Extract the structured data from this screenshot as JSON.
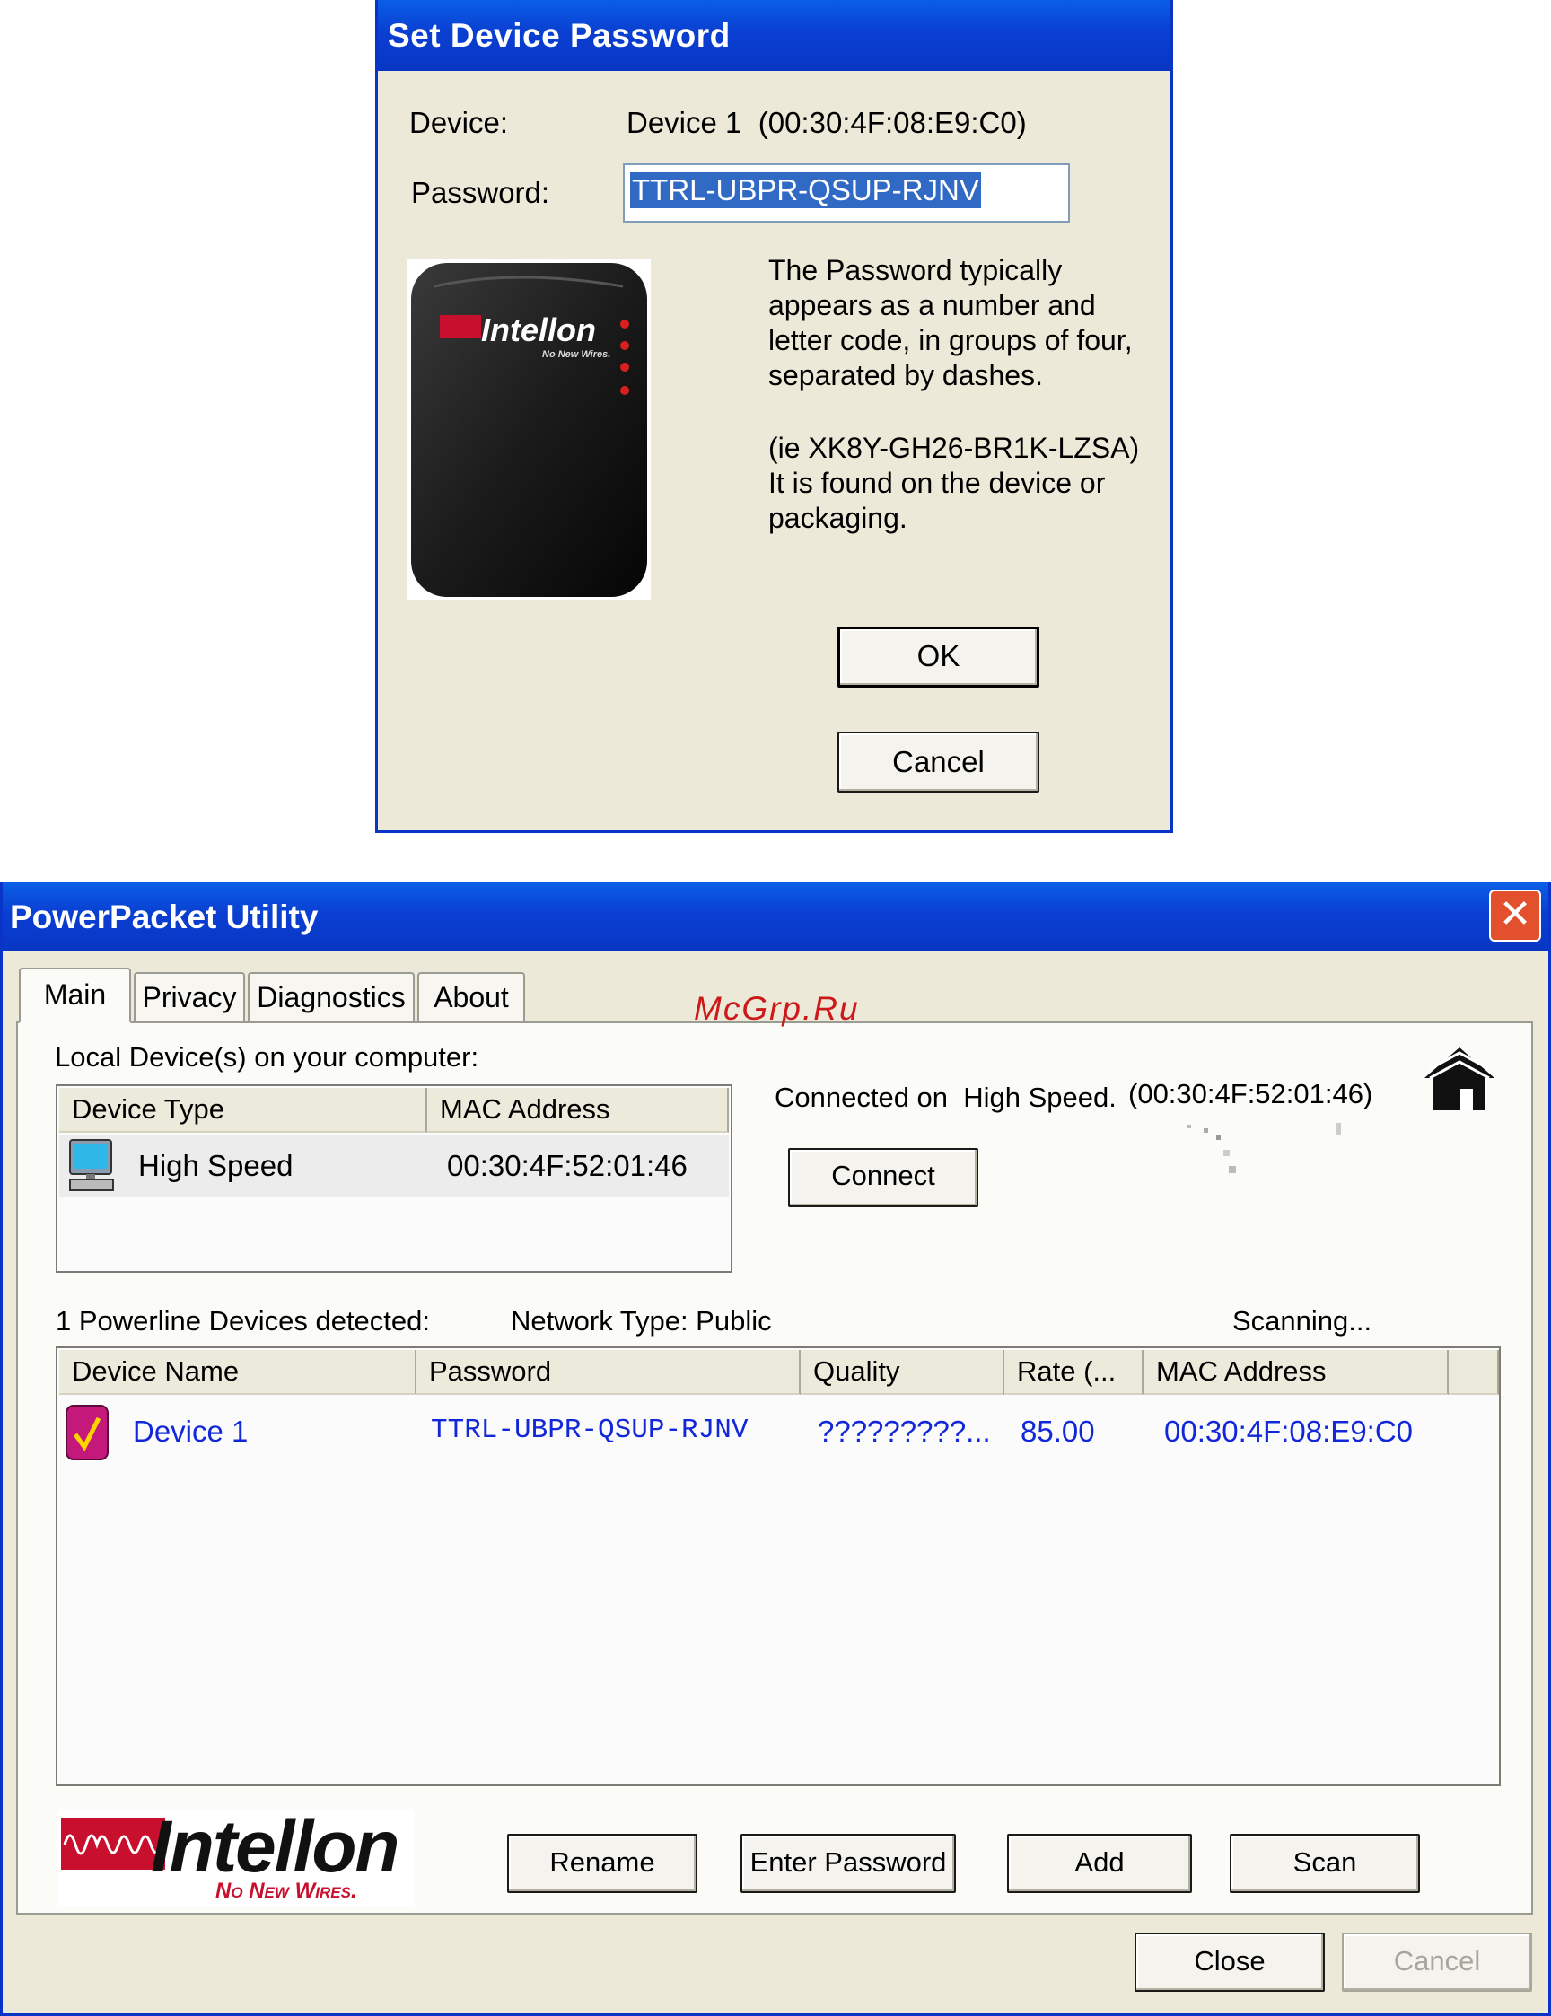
{
  "set_password_dialog": {
    "title": "Set Device Password",
    "device_label": "Device:",
    "device_value": "Device 1  (00:30:4F:08:E9:C0)",
    "password_label": "Password:",
    "password_value": "TTRL-UBPR-QSUP-RJNV",
    "device_image": {
      "brand": "Intellon",
      "tagline": "No New Wires."
    },
    "help_text_1": [
      "The Password typically",
      "appears as a number and",
      "letter code, in groups of four,",
      "separated by dashes."
    ],
    "help_text_2": [
      "(ie XK8Y-GH26-BR1K-LZSA)",
      "It is found on the device or",
      "packaging."
    ],
    "ok_label": "OK",
    "cancel_label": "Cancel"
  },
  "utility_window": {
    "title": "PowerPacket Utility",
    "tabs": [
      "Main",
      "Privacy",
      "Diagnostics",
      "About"
    ],
    "watermark": "McGrp.Ru",
    "local_devices_label": "Local Device(s) on your computer:",
    "local_table": {
      "columns": [
        "Device Type",
        "MAC Address"
      ],
      "rows": [
        {
          "type": "High Speed",
          "mac": "00:30:4F:52:01:46"
        }
      ]
    },
    "connected_text": "Connected on  High Speed.",
    "connected_mac": "(00:30:4F:52:01:46)",
    "connect_label": "Connect",
    "detected_text": "1 Powerline Devices detected:",
    "network_type": "Network Type: Public",
    "scanning": "Scanning...",
    "powerline_table": {
      "columns": [
        "Device Name",
        "Password",
        "Quality",
        "Rate (...",
        "MAC Address"
      ],
      "rows": [
        {
          "name": "Device 1",
          "password": "TTRL-UBPR-QSUP-RJNV",
          "quality": "?????????...",
          "rate": "85.00",
          "mac": "00:30:4F:08:E9:C0"
        }
      ]
    },
    "logo": {
      "brand": "Intellon",
      "tagline": "No New Wires."
    },
    "buttons": {
      "rename": "Rename",
      "enter_password": "Enter Password",
      "add": "Add",
      "scan": "Scan",
      "close": "Close",
      "cancel": "Cancel"
    },
    "icons": [
      "close-icon",
      "home-network-icon",
      "computer-icon",
      "powerline-device-icon"
    ]
  }
}
